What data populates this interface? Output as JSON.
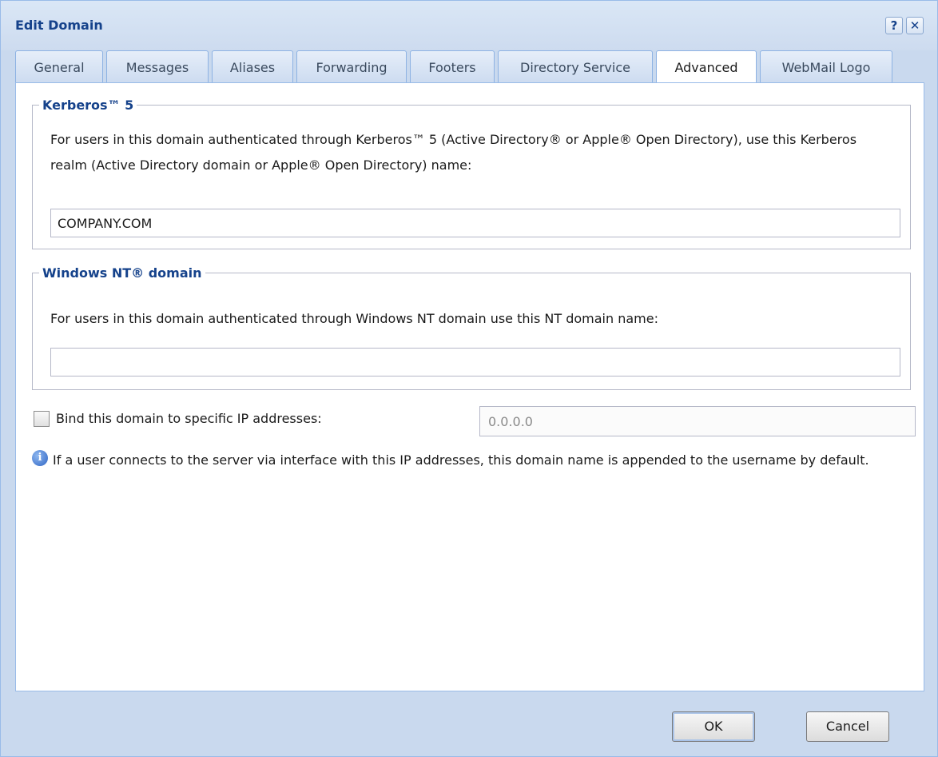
{
  "window": {
    "title": "Edit Domain",
    "help_glyph": "?",
    "close_glyph": "✕"
  },
  "tabs": [
    {
      "label": "General"
    },
    {
      "label": "Messages"
    },
    {
      "label": "Aliases"
    },
    {
      "label": "Forwarding"
    },
    {
      "label": "Footers"
    },
    {
      "label": "Directory Service"
    },
    {
      "label": "Advanced",
      "active": true
    },
    {
      "label": "WebMail Logo"
    }
  ],
  "kerberos": {
    "legend": "Kerberos™ 5",
    "description": "For users in this domain authenticated through Kerberos™ 5 (Active Directory® or Apple® Open Directory), use this Kerberos realm (Active Directory domain or Apple® Open Directory) name:",
    "realm_value": "COMPANY.COM"
  },
  "nt_domain": {
    "legend": "Windows NT® domain",
    "description": "For users in this domain authenticated through Windows NT domain use this NT domain name:",
    "value": ""
  },
  "bind_ip": {
    "label": "Bind this domain to specific IP addresses:",
    "checked": false,
    "value": "0.0.0.0"
  },
  "info": {
    "icon": "info-icon",
    "glyph": "i",
    "text": "If a user connects to the server via interface with this IP addresses, this domain name is appended to the username by default."
  },
  "buttons": {
    "ok": "OK",
    "cancel": "Cancel"
  }
}
